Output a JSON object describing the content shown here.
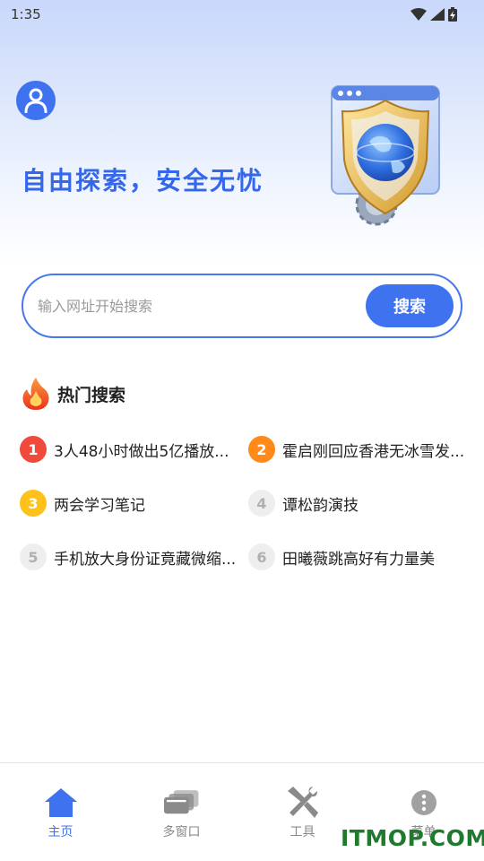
{
  "status_bar": {
    "time": "1:35"
  },
  "hero": {
    "slogan": "自由探索，安全无忧"
  },
  "search": {
    "placeholder": "输入网址开始搜索",
    "button_label": "搜索"
  },
  "hot_search": {
    "title": "热门搜索",
    "items": [
      {
        "rank": "1",
        "text": "3人48小时做出5亿播放...",
        "badge_color": "#f04a3c",
        "badge_text_color": "#ffffff"
      },
      {
        "rank": "2",
        "text": "霍启刚回应香港无冰雪发...",
        "badge_color": "#ff8a1a",
        "badge_text_color": "#ffffff"
      },
      {
        "rank": "3",
        "text": "两会学习笔记",
        "badge_color": "#ffc21a",
        "badge_text_color": "#ffffff"
      },
      {
        "rank": "4",
        "text": "谭松韵演技",
        "badge_color": "#eeeeee",
        "badge_text_color": "#b0b0b0"
      },
      {
        "rank": "5",
        "text": "手机放大身份证竟藏微缩...",
        "badge_color": "#eeeeee",
        "badge_text_color": "#b0b0b0"
      },
      {
        "rank": "6",
        "text": "田曦薇跳高好有力量美",
        "badge_color": "#eeeeee",
        "badge_text_color": "#b0b0b0"
      }
    ]
  },
  "bottom_nav": {
    "tabs": [
      {
        "label": "主页",
        "icon": "home-icon",
        "active": true
      },
      {
        "label": "多窗口",
        "icon": "windows-icon",
        "active": false
      },
      {
        "label": "工具",
        "icon": "tools-icon",
        "active": false
      },
      {
        "label": "菜单",
        "icon": "more-icon",
        "active": false
      }
    ]
  },
  "watermark": {
    "text": "ITMOP.COM"
  },
  "colors": {
    "accent": "#3f72ee",
    "nav_active": "#3f72ee",
    "nav_inactive": "#8a8a8a",
    "watermark": "#1f7a2e"
  }
}
